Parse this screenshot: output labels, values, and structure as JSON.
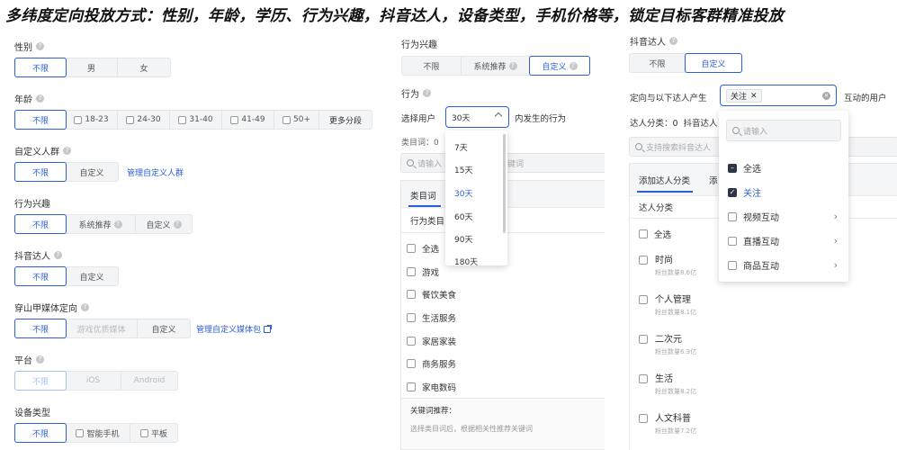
{
  "headline": "多纬度定向投放方式：性别，年龄，学历、行为兴趣，抖音达人，设备类型，手机价格等，锁定目标客群精准投放",
  "col1": {
    "gender": {
      "title": "性别",
      "options": [
        "不限",
        "男",
        "女"
      ]
    },
    "age": {
      "title": "年龄",
      "options": [
        "不限",
        "18-23",
        "24-30",
        "31-40",
        "41-49",
        "50+"
      ],
      "more": "更多分段"
    },
    "custom_crowd": {
      "title": "自定义人群",
      "options": [
        "不限",
        "自定义"
      ],
      "link": "管理自定义人群"
    },
    "interest": {
      "title": "行为兴趣",
      "options": [
        "不限",
        "系统推荐",
        "自定义"
      ]
    },
    "douyin": {
      "title": "抖音达人",
      "options": [
        "不限",
        "自定义"
      ]
    },
    "pangle": {
      "title": "穿山甲媒体定向",
      "options": [
        "不限",
        "游戏优质媒体",
        "自定义"
      ],
      "link": "管理自定义媒体包"
    },
    "platform": {
      "title": "平台",
      "options": [
        "不限",
        "iOS",
        "Android"
      ]
    },
    "device": {
      "title": "设备类型",
      "options": [
        "不限",
        "智能手机",
        "平板"
      ]
    }
  },
  "col2": {
    "title": "行为兴趣",
    "options": [
      "不限",
      "系统推荐",
      "自定义"
    ],
    "behavior_title": "行为",
    "select_user_label": "选择用户",
    "select_value": "30天",
    "select_suffix": "内发生的行为",
    "category_count_label": "类目词：0",
    "search_placeholder": "请输入",
    "search_suffix": "关键词",
    "tab_label": "类目词",
    "list_header": "行为类目",
    "dropdown": [
      "7天",
      "15天",
      "30天",
      "60天",
      "90天",
      "180天"
    ],
    "categories": [
      "全选",
      "游戏",
      "餐饮美食",
      "生活服务",
      "家居家装",
      "商务服务",
      "家电数码"
    ],
    "keyword_title": "关键词推荐：",
    "keyword_hint": "选择类目词后，根据相关性推荐关键词"
  },
  "col3": {
    "title": "抖音达人",
    "options": [
      "不限",
      "自定义"
    ],
    "interact_prefix": "定向与以下达人产生",
    "chip": "关注",
    "interact_suffix": "互动的用户",
    "count_label": "达人分类：0",
    "count_label2": "抖音达人",
    "search_placeholder": "支持搜索抖音达人",
    "tab_active": "添加达人分类",
    "tab_other": "添",
    "list_header": "达人分类",
    "select_all": "全选",
    "kols": [
      {
        "name": "时尚",
        "fans": "粉丝数量8.6亿"
      },
      {
        "name": "个人管理",
        "fans": "粉丝数量8.1亿"
      },
      {
        "name": "二次元",
        "fans": "粉丝数量6.3亿"
      },
      {
        "name": "生活",
        "fans": "粉丝数量8.2亿"
      },
      {
        "name": "人文科普",
        "fans": "粉丝数量7.2亿"
      }
    ],
    "dropdown_search": "请输入",
    "dropdown_items": [
      {
        "label": "全选",
        "state": "partial",
        "arrow": false
      },
      {
        "label": "关注",
        "state": "checked",
        "arrow": false
      },
      {
        "label": "视频互动",
        "state": "none",
        "arrow": true
      },
      {
        "label": "直播互动",
        "state": "none",
        "arrow": true
      },
      {
        "label": "商品互动",
        "state": "none",
        "arrow": true
      }
    ]
  }
}
